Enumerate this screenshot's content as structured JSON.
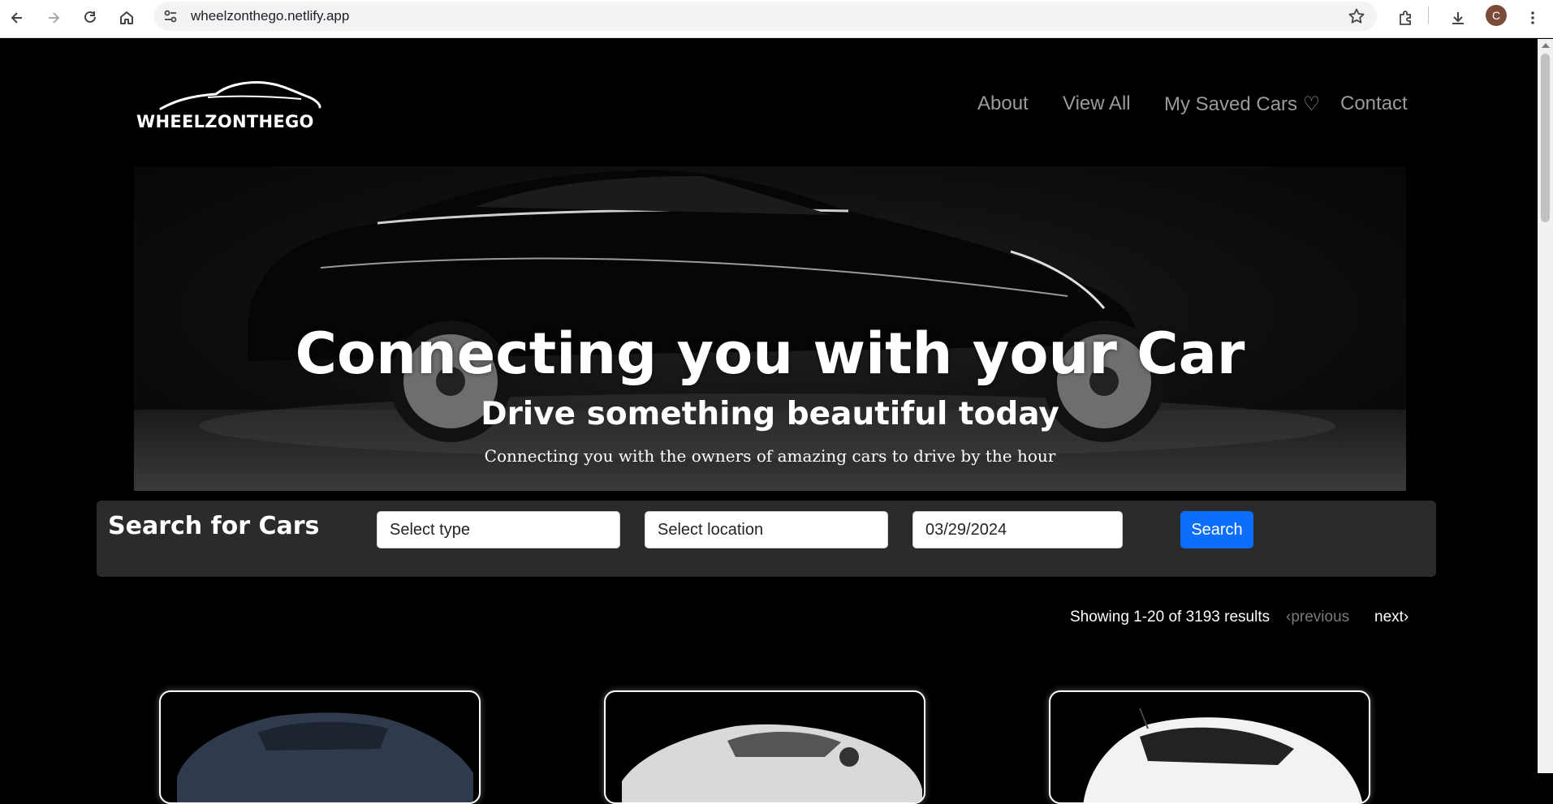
{
  "browser": {
    "url": "wheelzonthego.netlify.app",
    "profile_initial": "C",
    "icons": [
      "back-icon",
      "forward-icon",
      "reload-icon",
      "home-icon",
      "site-info-icon",
      "bookmark-star-icon",
      "extensions-icon",
      "download-icon",
      "menu-dots-icon"
    ]
  },
  "site": {
    "logo_text": "WHEELZONTHEGO",
    "nav": {
      "about": "About",
      "view_all": "View All",
      "saved": "My Saved Cars ♡",
      "contact": "Contact"
    }
  },
  "hero": {
    "title": "Connecting you with your Car",
    "subtitle": "Drive something beautiful today",
    "tagline": "Connecting you with the owners of amazing cars to drive by the hour"
  },
  "search": {
    "title": "Search for Cars",
    "type_placeholder": "Select type",
    "location_placeholder": "Select location",
    "date_value": "03/29/2024",
    "button_label": "Search"
  },
  "pagination": {
    "results_text": "Showing 1-20 of 3193 results",
    "previous_label": "previous",
    "next_label": "next"
  },
  "colors": {
    "page_bg": "#000000",
    "search_bar_bg": "#2b2b2b",
    "primary_button": "#0d6efd",
    "nav_text": "#9a9a9a"
  }
}
